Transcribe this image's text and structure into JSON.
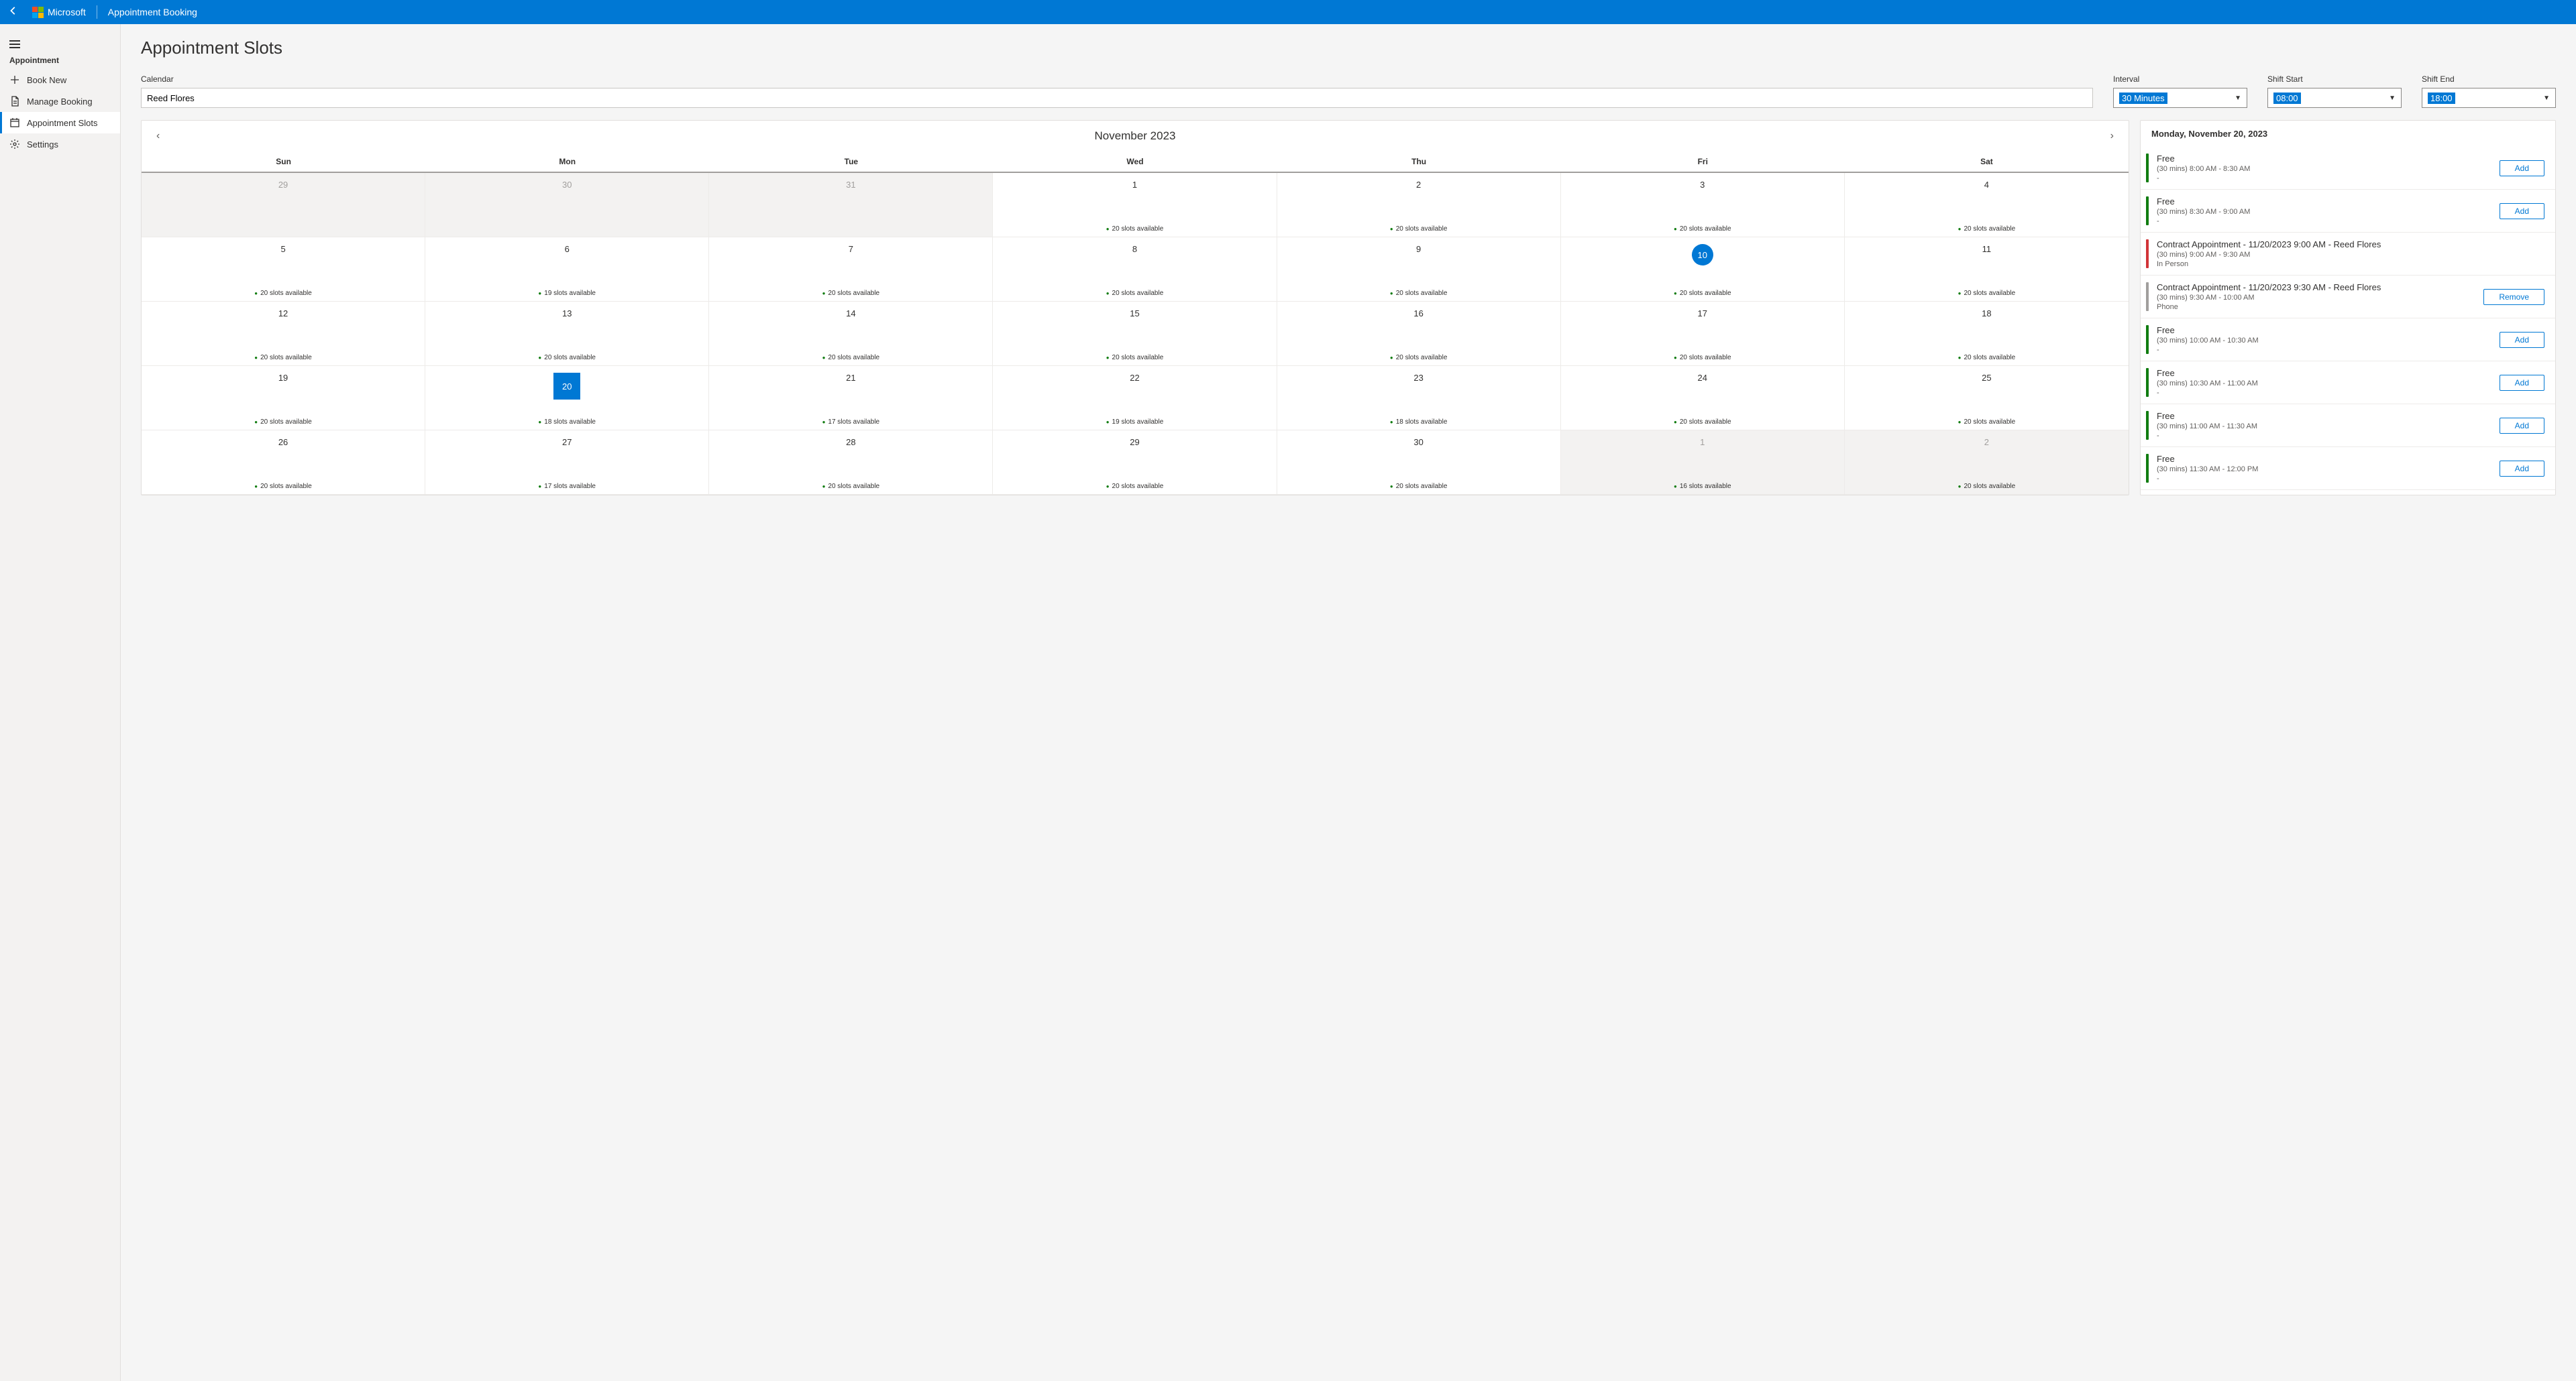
{
  "header": {
    "logo_text": "Microsoft",
    "app_title": "Appointment Booking"
  },
  "sidebar": {
    "group_label": "Appointment",
    "items": [
      {
        "label": "Book New",
        "icon": "plus"
      },
      {
        "label": "Manage Booking",
        "icon": "doc"
      },
      {
        "label": "Appointment Slots",
        "icon": "calendar",
        "active": true
      },
      {
        "label": "Settings",
        "icon": "gear"
      }
    ]
  },
  "page": {
    "title": "Appointment Slots"
  },
  "controls": {
    "calendar_label": "Calendar",
    "calendar_value": "Reed Flores",
    "interval_label": "Interval",
    "interval_value": "30 Minutes",
    "shift_start_label": "Shift Start",
    "shift_start_value": "08:00",
    "shift_end_label": "Shift End",
    "shift_end_value": "18:00"
  },
  "calendar": {
    "title": "November 2023",
    "dow": [
      "Sun",
      "Mon",
      "Tue",
      "Wed",
      "Thu",
      "Fri",
      "Sat"
    ],
    "weeks": [
      [
        {
          "d": "29",
          "out": true
        },
        {
          "d": "30",
          "out": true
        },
        {
          "d": "31",
          "out": true
        },
        {
          "d": "1",
          "avail": "20 slots available"
        },
        {
          "d": "2",
          "avail": "20 slots available"
        },
        {
          "d": "3",
          "avail": "20 slots available"
        },
        {
          "d": "4",
          "avail": "20 slots available"
        }
      ],
      [
        {
          "d": "5",
          "avail": "20 slots available"
        },
        {
          "d": "6",
          "avail": "19 slots available"
        },
        {
          "d": "7",
          "avail": "20 slots available"
        },
        {
          "d": "8",
          "avail": "20 slots available"
        },
        {
          "d": "9",
          "avail": "20 slots available"
        },
        {
          "d": "10",
          "avail": "20 slots available",
          "today": true
        },
        {
          "d": "11",
          "avail": "20 slots available"
        }
      ],
      [
        {
          "d": "12",
          "avail": "20 slots available"
        },
        {
          "d": "13",
          "avail": "20 slots available"
        },
        {
          "d": "14",
          "avail": "20 slots available"
        },
        {
          "d": "15",
          "avail": "20 slots available"
        },
        {
          "d": "16",
          "avail": "20 slots available"
        },
        {
          "d": "17",
          "avail": "20 slots available"
        },
        {
          "d": "18",
          "avail": "20 slots available"
        }
      ],
      [
        {
          "d": "19",
          "avail": "20 slots available"
        },
        {
          "d": "20",
          "avail": "18 slots available",
          "selected": true
        },
        {
          "d": "21",
          "avail": "17 slots available"
        },
        {
          "d": "22",
          "avail": "19 slots available"
        },
        {
          "d": "23",
          "avail": "18 slots available"
        },
        {
          "d": "24",
          "avail": "20 slots available"
        },
        {
          "d": "25",
          "avail": "20 slots available"
        }
      ],
      [
        {
          "d": "26",
          "avail": "20 slots available"
        },
        {
          "d": "27",
          "avail": "17 slots available"
        },
        {
          "d": "28",
          "avail": "20 slots available"
        },
        {
          "d": "29",
          "avail": "20 slots available"
        },
        {
          "d": "30",
          "avail": "20 slots available"
        },
        {
          "d": "1",
          "out": true,
          "avail": "16 slots available"
        },
        {
          "d": "2",
          "out": true,
          "avail": "20 slots available"
        }
      ]
    ]
  },
  "slots": {
    "date": "Monday, November 20, 2023",
    "add_label": "Add",
    "remove_label": "Remove",
    "items": [
      {
        "status": "green",
        "title": "Free",
        "sub": "(30 mins) 8:00 AM - 8:30 AM",
        "loc": "-",
        "action": "add"
      },
      {
        "status": "green",
        "title": "Free",
        "sub": "(30 mins) 8:30 AM - 9:00 AM",
        "loc": "-",
        "action": "add"
      },
      {
        "status": "red",
        "title": "Contract Appointment - 11/20/2023 9:00 AM  - Reed Flores",
        "sub": "(30 mins) 9:00 AM - 9:30 AM",
        "loc": "In Person",
        "action": "none"
      },
      {
        "status": "gray",
        "title": "Contract Appointment - 11/20/2023 9:30 AM  - Reed Flores",
        "sub": "(30 mins) 9:30 AM - 10:00 AM",
        "loc": "Phone",
        "action": "remove"
      },
      {
        "status": "green",
        "title": "Free",
        "sub": "(30 mins) 10:00 AM - 10:30 AM",
        "loc": "-",
        "action": "add"
      },
      {
        "status": "green",
        "title": "Free",
        "sub": "(30 mins) 10:30 AM - 11:00 AM",
        "loc": "-",
        "action": "add"
      },
      {
        "status": "green",
        "title": "Free",
        "sub": "(30 mins) 11:00 AM - 11:30 AM",
        "loc": "-",
        "action": "add"
      },
      {
        "status": "green",
        "title": "Free",
        "sub": "(30 mins) 11:30 AM - 12:00 PM",
        "loc": "-",
        "action": "add"
      }
    ]
  }
}
